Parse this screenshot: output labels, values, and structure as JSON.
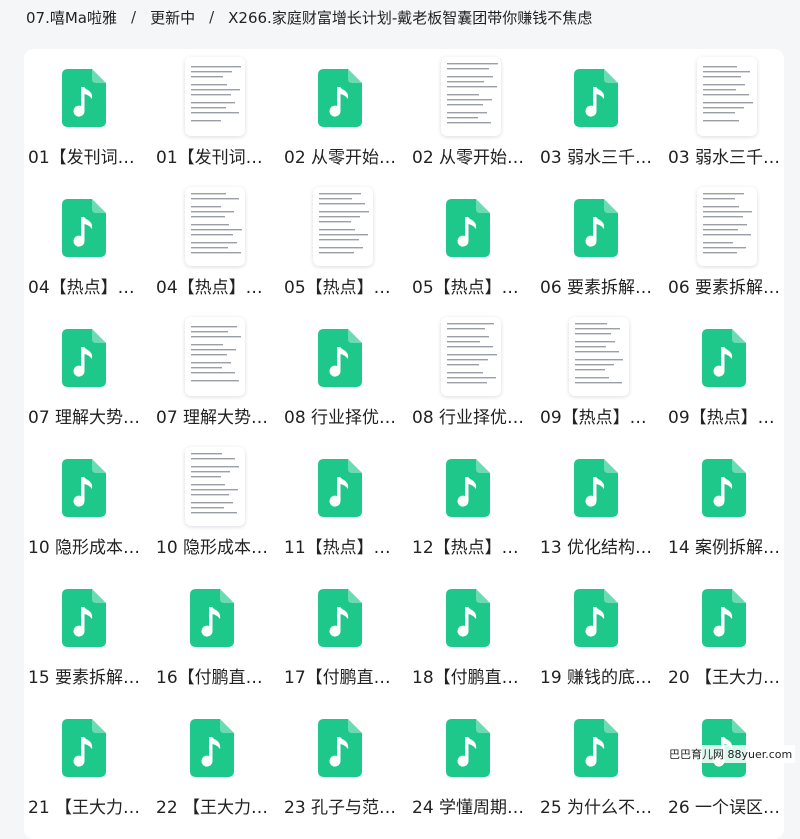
{
  "breadcrumb": {
    "items": [
      "07.嘻Ma啦雅",
      "更新中",
      "X266.家庭财富增长计划-戴老板智囊团带你赚钱不焦虑"
    ],
    "separator": "/"
  },
  "colors": {
    "audio_icon": "#1ec78a",
    "page_bg": "#f5f6f8",
    "panel_bg": "#ffffff"
  },
  "files": [
    {
      "label": "01【发刊词…",
      "type": "audio"
    },
    {
      "label": "01【发刊词…",
      "type": "document"
    },
    {
      "label": "02 从零开始…",
      "type": "audio"
    },
    {
      "label": "02 从零开始…",
      "type": "document"
    },
    {
      "label": "03 弱水三千…",
      "type": "audio"
    },
    {
      "label": "03 弱水三千…",
      "type": "document"
    },
    {
      "label": "04【热点】…",
      "type": "audio"
    },
    {
      "label": "04【热点】…",
      "type": "document"
    },
    {
      "label": "05【热点】…",
      "type": "document"
    },
    {
      "label": "05【热点】…",
      "type": "audio"
    },
    {
      "label": "06 要素拆解…",
      "type": "audio"
    },
    {
      "label": "06 要素拆解…",
      "type": "document"
    },
    {
      "label": "07 理解大势…",
      "type": "audio"
    },
    {
      "label": "07 理解大势…",
      "type": "document"
    },
    {
      "label": "08 行业择优…",
      "type": "audio"
    },
    {
      "label": "08 行业择优…",
      "type": "document"
    },
    {
      "label": "09【热点】…",
      "type": "document"
    },
    {
      "label": "09【热点】…",
      "type": "audio"
    },
    {
      "label": "10 隐形成本…",
      "type": "audio"
    },
    {
      "label": "10 隐形成本…",
      "type": "document"
    },
    {
      "label": "11【热点】…",
      "type": "audio"
    },
    {
      "label": "12【热点】…",
      "type": "audio"
    },
    {
      "label": "13 优化结构…",
      "type": "audio"
    },
    {
      "label": "14 案例拆解…",
      "type": "audio"
    },
    {
      "label": "15 要素拆解…",
      "type": "audio"
    },
    {
      "label": "16【付鹏直…",
      "type": "audio"
    },
    {
      "label": "17【付鹏直…",
      "type": "audio"
    },
    {
      "label": "18【付鹏直…",
      "type": "audio"
    },
    {
      "label": "19 赚钱的底…",
      "type": "audio"
    },
    {
      "label": "20 【王大力…",
      "type": "audio"
    },
    {
      "label": "21 【王大力…",
      "type": "audio"
    },
    {
      "label": "22 【王大力…",
      "type": "audio"
    },
    {
      "label": "23 孔子与范…",
      "type": "audio"
    },
    {
      "label": "24 学懂周期…",
      "type": "audio"
    },
    {
      "label": "25 为什么不…",
      "type": "audio"
    },
    {
      "label": "26 一个误区…",
      "type": "audio"
    }
  ],
  "watermark": "巴巴育儿网 88yuer.com"
}
